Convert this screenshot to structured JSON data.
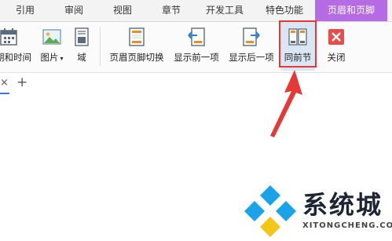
{
  "tabs": [
    {
      "label": "引用"
    },
    {
      "label": "审阅"
    },
    {
      "label": "视图"
    },
    {
      "label": "章节"
    },
    {
      "label": "开发工具"
    },
    {
      "label": "特色功能"
    },
    {
      "label": "页眉和页脚"
    }
  ],
  "ribbon": {
    "date_time_label": "期和时间",
    "picture_label": "图片",
    "field_label": "域",
    "switch_header_footer_label": "页眉页脚切换",
    "show_previous_label": "显示前一项",
    "show_next_label": "显示后一项",
    "same_as_previous_label": "同前节",
    "close_label": "关闭"
  },
  "doc_tabs": {
    "close_glyph": "×",
    "add_glyph": "+"
  },
  "watermark": {
    "title": "系统城",
    "subtitle": "XITONGCHENG.COM"
  },
  "colors": {
    "active_tab": "#b46be3",
    "highlight": "#e53935",
    "close_red": "#e94b4b",
    "watermark_blue": "#1aa3e8"
  }
}
